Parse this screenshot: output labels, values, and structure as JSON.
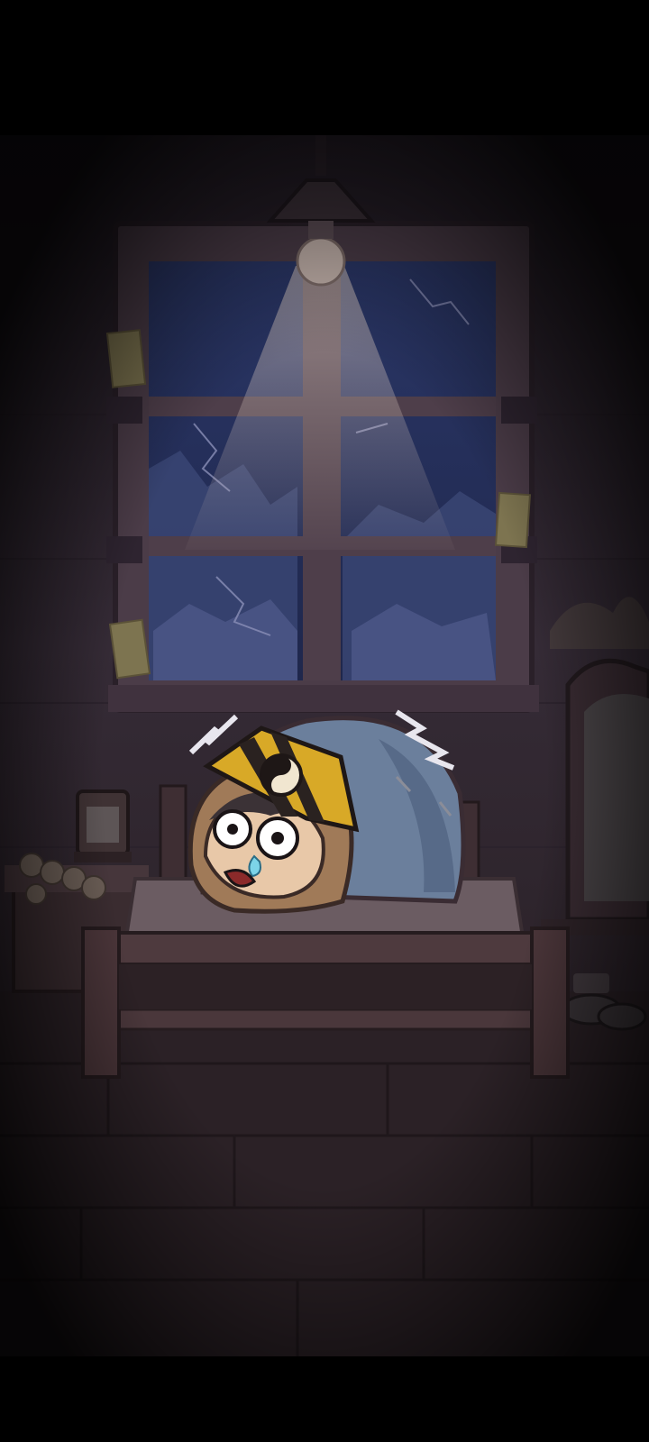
{
  "screen": {
    "kind": "game-intro-cutscene",
    "letterbox_color": "#000000"
  },
  "scene": {
    "setting": "dark-haunted-bedroom",
    "window": {
      "panes": 6,
      "cracked": true
    },
    "lamp": {
      "lit": true
    },
    "character": {
      "state": "hiding-under-blanket",
      "expression": "scared",
      "forehead_talisman": "taiji-symbol"
    },
    "props": [
      "ceiling-lamp",
      "paper-talismans",
      "oil-lantern",
      "coin-string",
      "wooden-bed",
      "blanket",
      "mirror-frame",
      "clay-pots"
    ],
    "effects": [
      "trembling-lines"
    ]
  },
  "colors": {
    "wall": "#2e2530",
    "floor": "#2d2328",
    "light_beam": "#c9b8b0",
    "window_glass": "#26305a",
    "blanket": "#6b7f9c",
    "talisman": "#d8a927",
    "wood": "#4a3535"
  }
}
